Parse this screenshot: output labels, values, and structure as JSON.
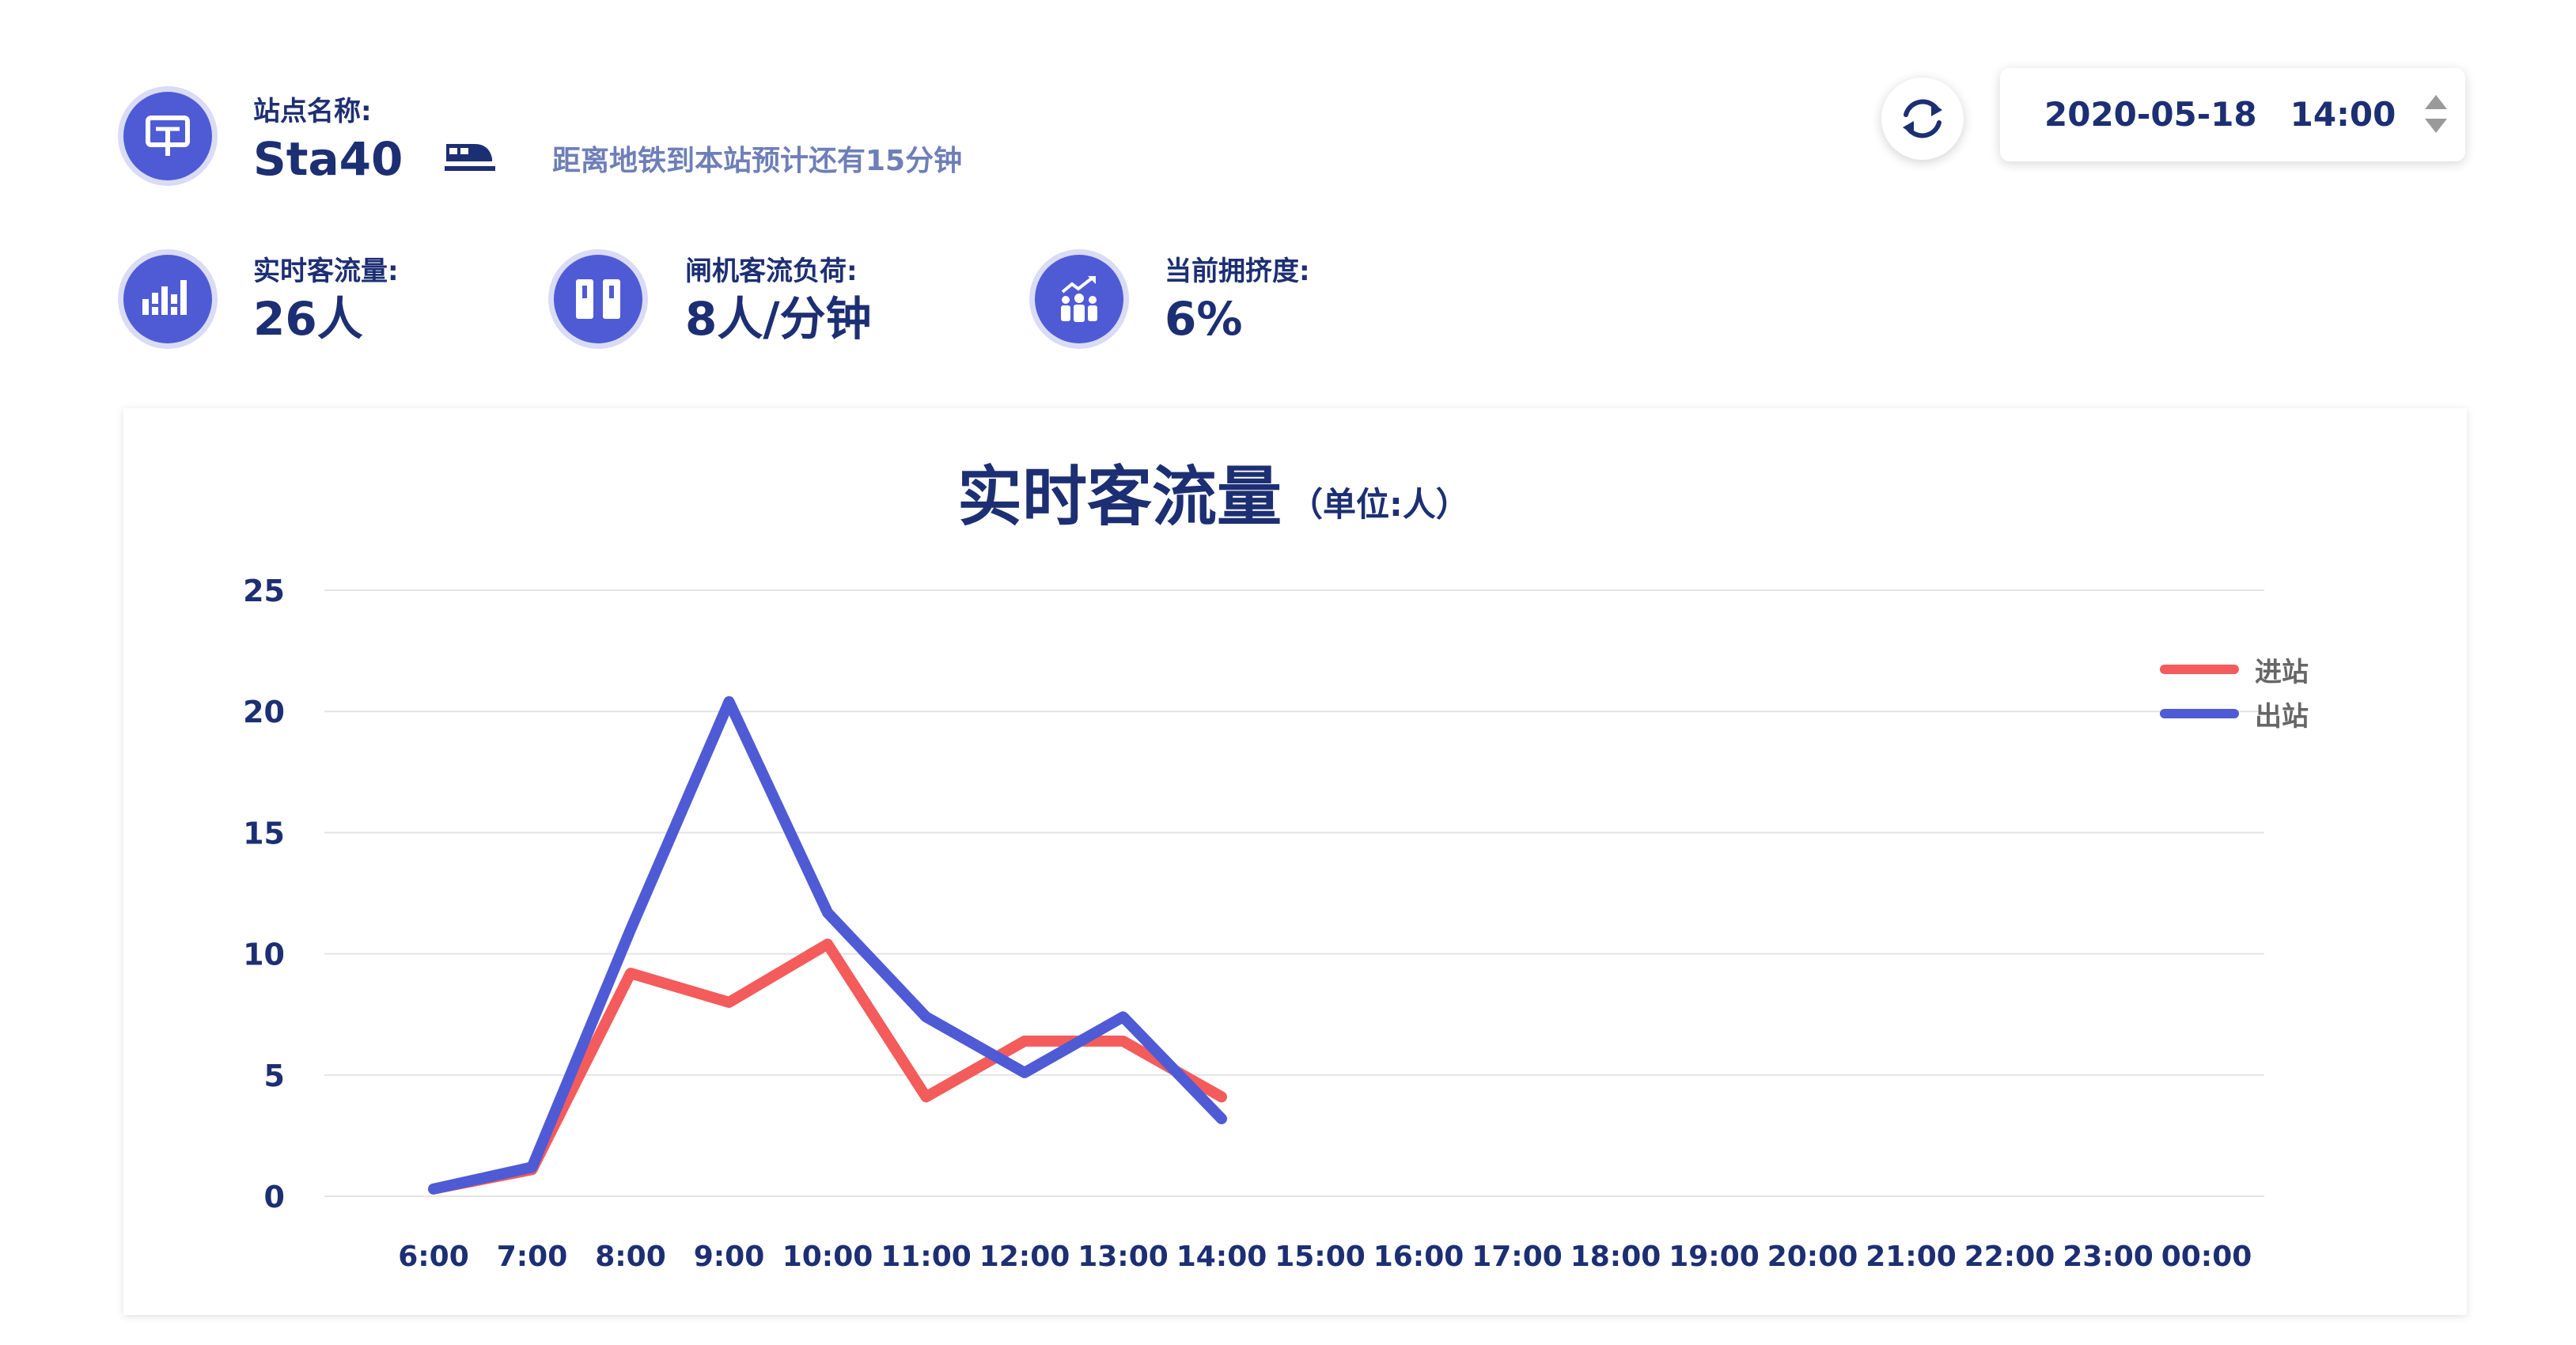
{
  "station": {
    "name_label": "站点名称:",
    "name": "Sta40",
    "eta_text": "距离地铁到本站预计还有15分钟",
    "icon": "station-sign-icon",
    "train_icon": "train-icon"
  },
  "datetime": {
    "date": "2020-05-18",
    "time": "14:00",
    "refresh_icon": "refresh-icon",
    "stepper_icon": "up-down-stepper-icon"
  },
  "metrics": [
    {
      "label": "实时客流量:",
      "value": "26人",
      "icon": "bar-chart-icon"
    },
    {
      "label": "闸机客流负荷:",
      "value": "8人/分钟",
      "icon": "gate-icon"
    },
    {
      "label": "当前拥挤度:",
      "value": "6%",
      "icon": "crowd-icon"
    }
  ],
  "colors": {
    "primary": "#4f5bd5",
    "text_dark": "#1d2f73",
    "inbound": "#f45b5b",
    "outbound": "#4f5bd5"
  },
  "chart_data": {
    "type": "line",
    "title": "实时客流量",
    "subtitle": "（单位:人）",
    "categories": [
      "6:00",
      "7:00",
      "8:00",
      "9:00",
      "10:00",
      "11:00",
      "12:00",
      "13:00",
      "14:00",
      "15:00",
      "16:00",
      "17:00",
      "18:00",
      "19:00",
      "20:00",
      "21:00",
      "22:00",
      "23:00",
      "00:00"
    ],
    "ylim": [
      0,
      25
    ],
    "yticks": [
      0,
      5,
      10,
      15,
      20,
      25
    ],
    "grid": true,
    "legend_position": "right",
    "series": [
      {
        "name": "进站",
        "color": "#f45b5b",
        "points": [
          [
            0,
            0.3
          ],
          [
            1,
            1.1
          ],
          [
            2,
            9.2
          ],
          [
            3,
            8.0
          ],
          [
            4,
            10.4
          ],
          [
            5,
            4.1
          ],
          [
            6,
            6.4
          ],
          [
            7,
            6.4
          ],
          [
            8,
            4.1
          ]
        ]
      },
      {
        "name": "出站",
        "color": "#4f5bd5",
        "points": [
          [
            0,
            0.3
          ],
          [
            1,
            1.2
          ],
          [
            2,
            11.0
          ],
          [
            3,
            20.4
          ],
          [
            4,
            11.7
          ],
          [
            5,
            7.4
          ],
          [
            6,
            5.1
          ],
          [
            7,
            7.4
          ],
          [
            8,
            3.2
          ]
        ]
      }
    ]
  }
}
